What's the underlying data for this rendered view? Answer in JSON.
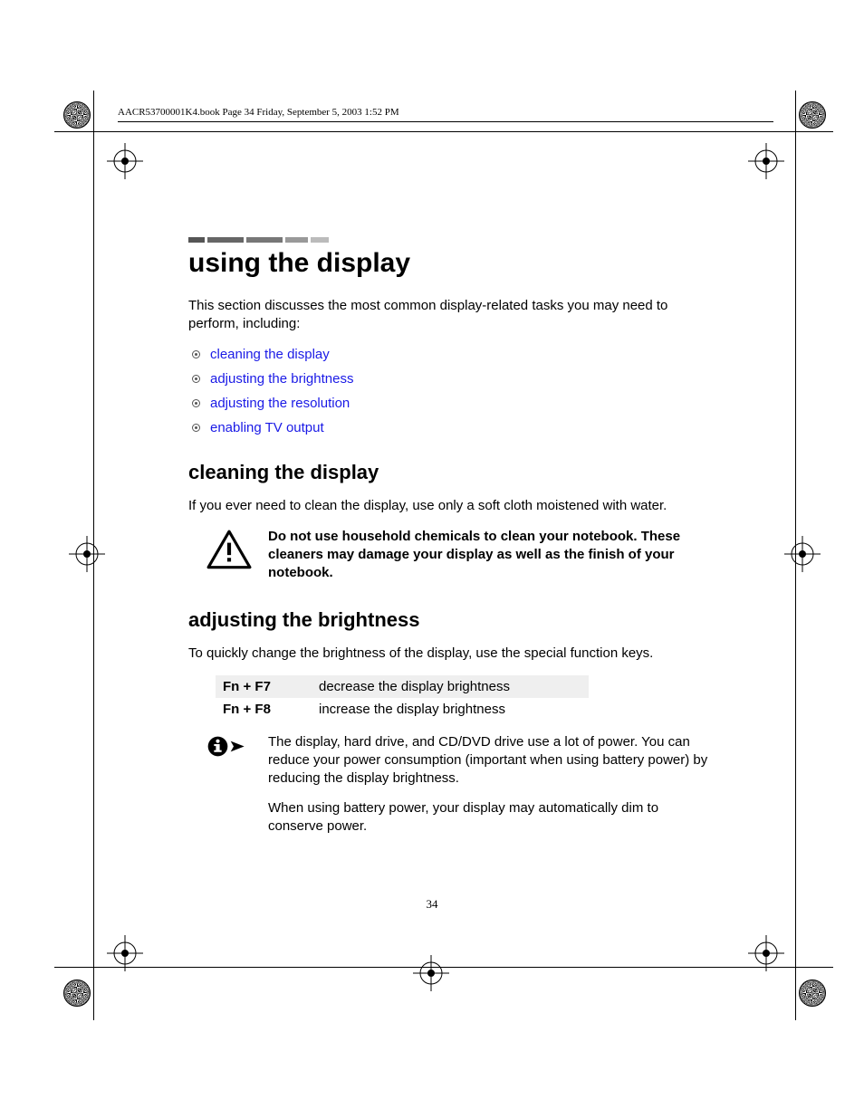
{
  "header": "AACR53700001K4.book  Page 34  Friday, September 5, 2003  1:52 PM",
  "title": "using the display",
  "intro": "This section discusses the most common display-related tasks you may need to perform, including:",
  "links": [
    "cleaning the display",
    "adjusting the brightness",
    "adjusting the resolution",
    "enabling TV output"
  ],
  "sections": {
    "cleaning": {
      "heading": "cleaning the display",
      "body": "If you ever need to clean the display, use only a soft cloth moistened with water.",
      "warning": "Do not use household chemicals to clean your notebook. These cleaners may damage your display as well as the finish of your notebook."
    },
    "brightness": {
      "heading": "adjusting the brightness",
      "body": "To quickly change the brightness of the display, use the special function keys.",
      "table": [
        {
          "key": "Fn + F7",
          "desc": "decrease the display brightness"
        },
        {
          "key": "Fn + F8",
          "desc": "increase the display brightness"
        }
      ],
      "note1": "The display, hard drive, and CD/DVD drive use a lot of power. You can reduce your power consumption (important when using battery power) by reducing the display brightness.",
      "note2": "When using battery power, your display may automatically dim to conserve power."
    }
  },
  "page_number": "34"
}
